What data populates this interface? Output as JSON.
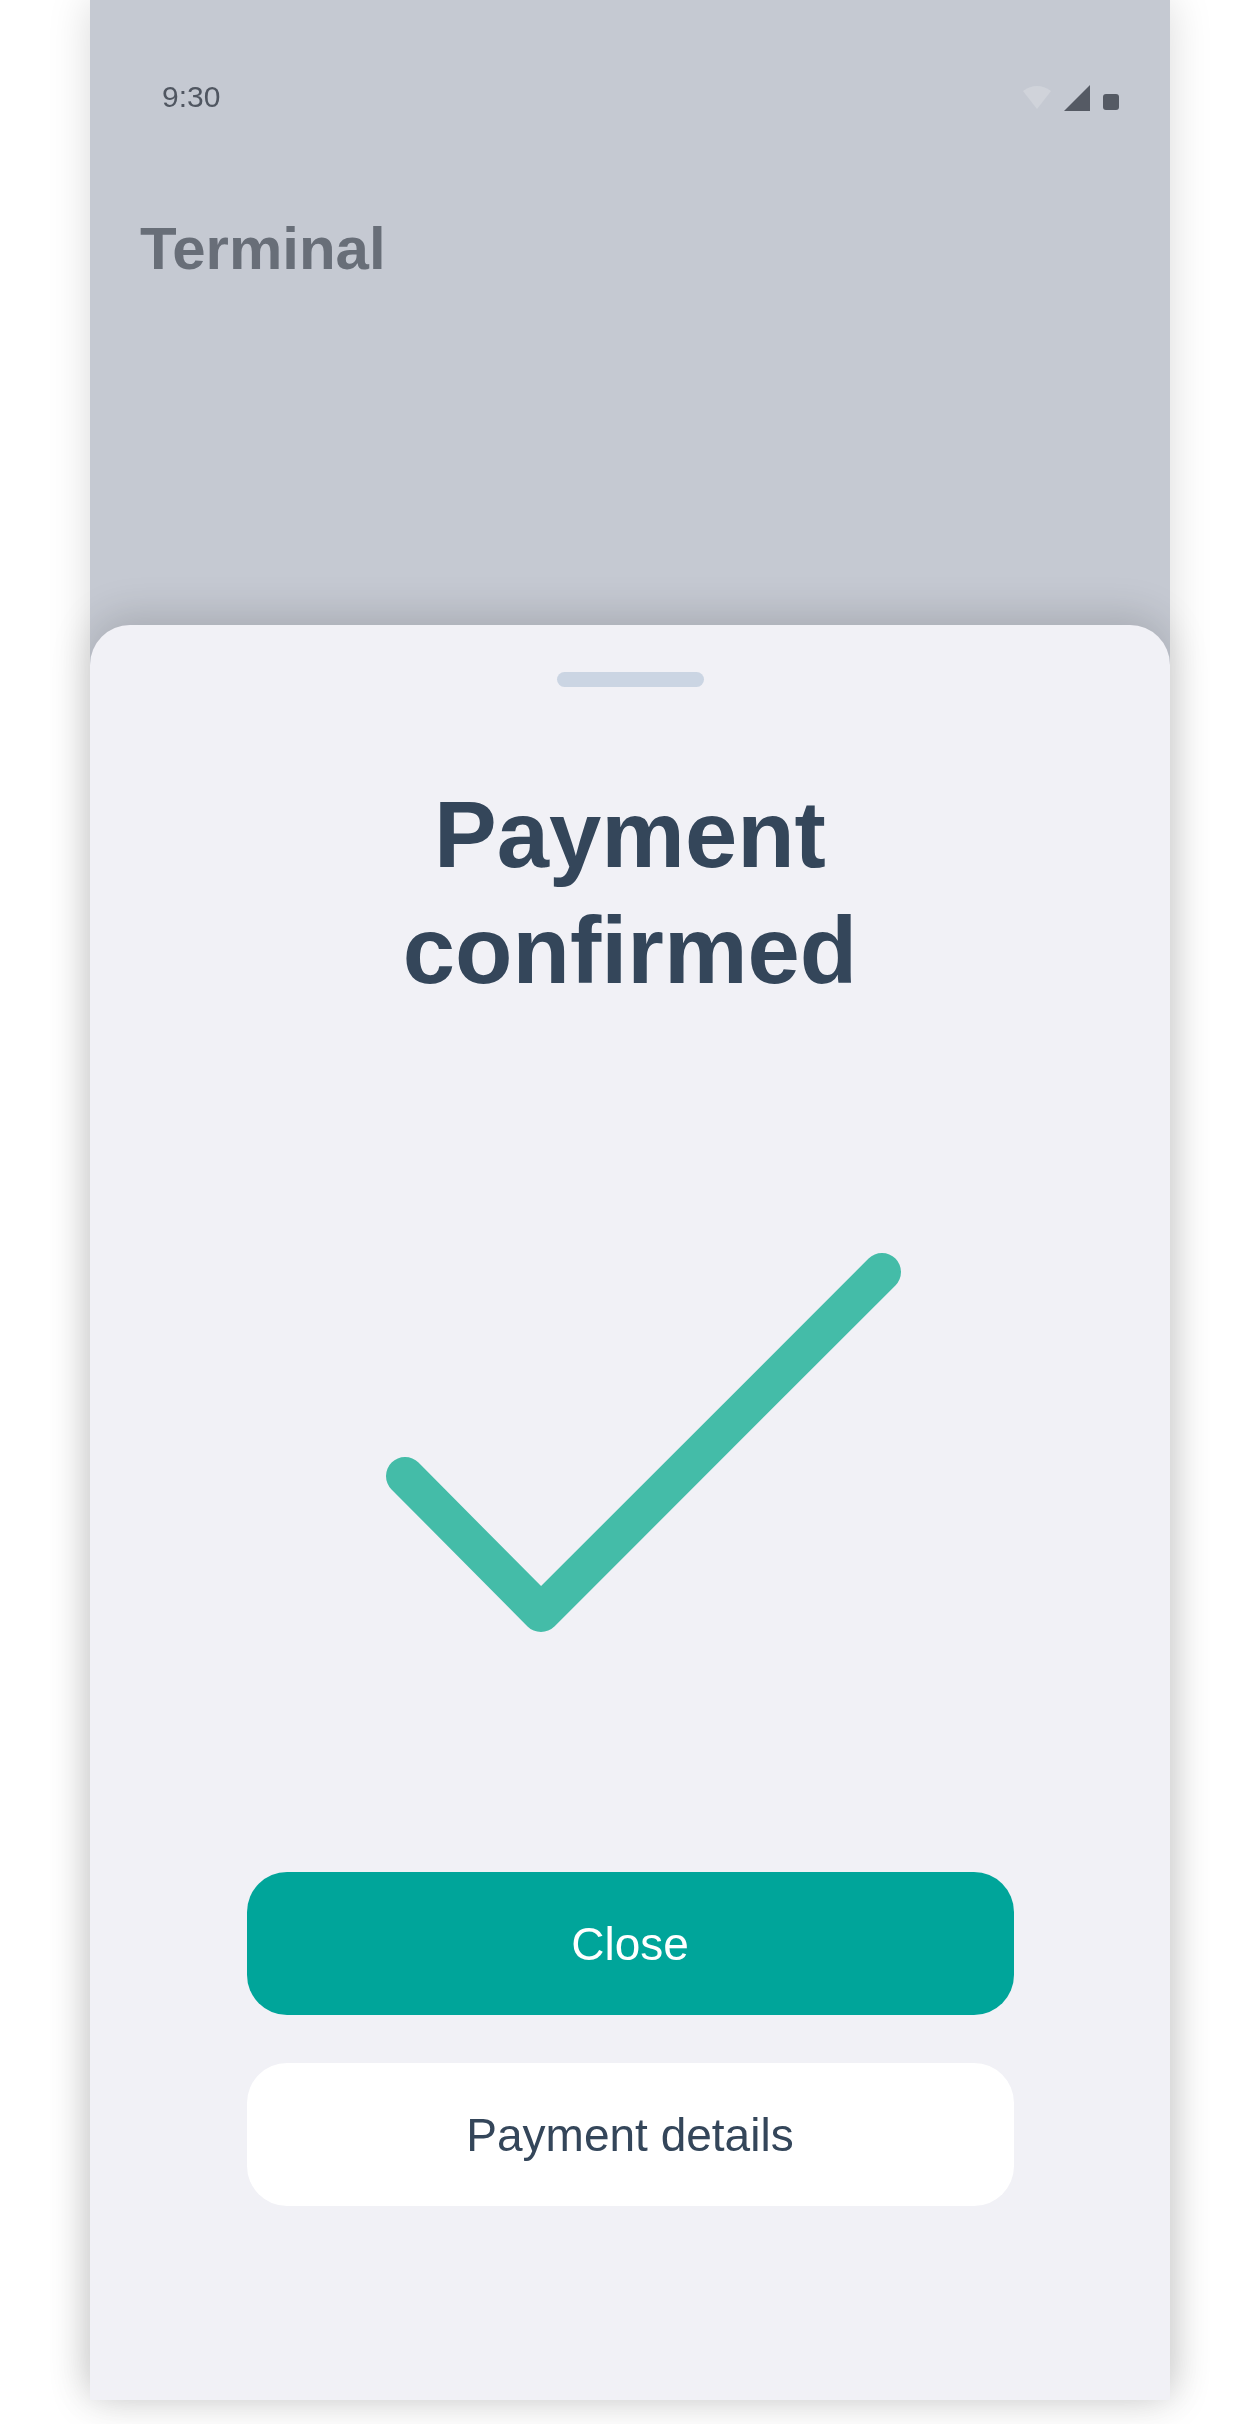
{
  "status_bar": {
    "time": "9:30"
  },
  "screen": {
    "title": "Terminal"
  },
  "sheet": {
    "title": "Payment confirmed",
    "buttons": [
      {
        "label": "Close",
        "kind": "primary"
      },
      {
        "label": "Payment details",
        "kind": "secondary"
      }
    ]
  }
}
